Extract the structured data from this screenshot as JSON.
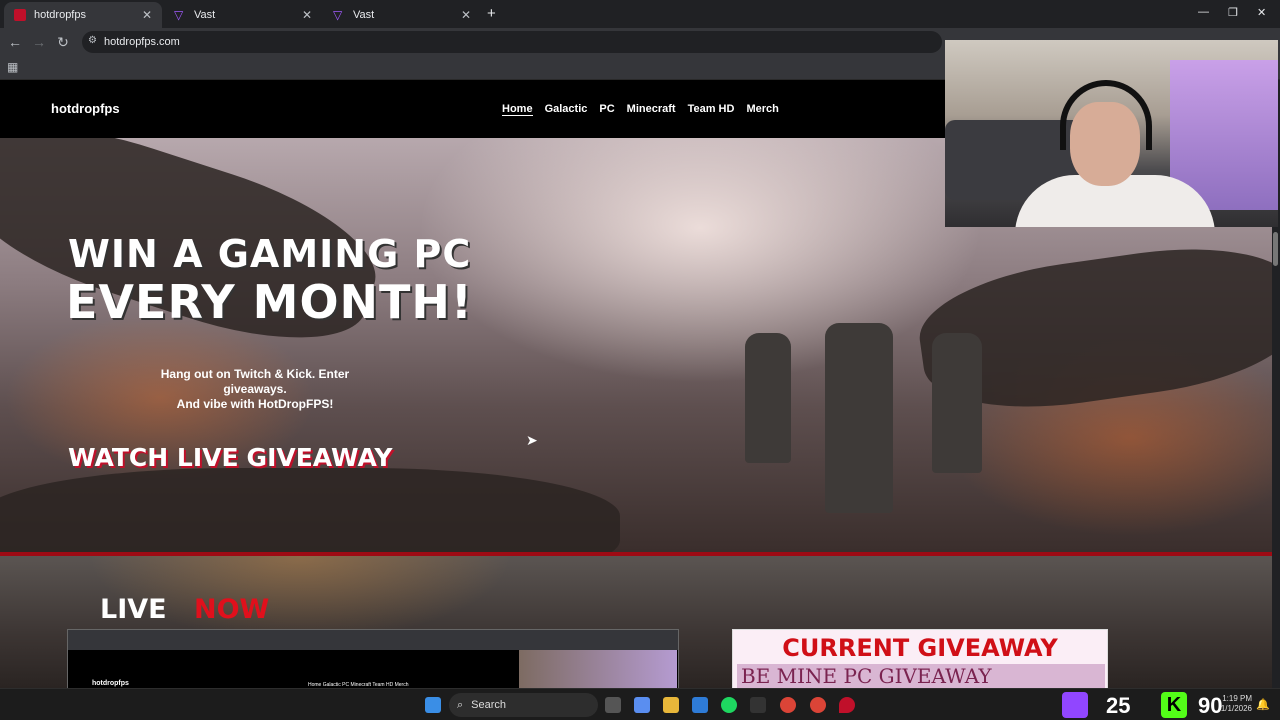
{
  "browser": {
    "tabs": [
      {
        "title": "hotdropfps",
        "active": true
      },
      {
        "title": "Vast",
        "active": false
      },
      {
        "title": "Vast",
        "active": false
      }
    ],
    "url": "hotdropfps.com"
  },
  "site": {
    "brand": "hotdropfps",
    "nav": [
      "Home",
      "Galactic",
      "PC",
      "Minecraft",
      "Team HD",
      "Merch"
    ],
    "hero": {
      "headline_1": "WIN A GAMING PC",
      "headline_2": "EVERY MONTH!",
      "tagline_1": "Hang out on Twitch & Kick. Enter giveaways.",
      "tagline_2": "And vibe with HotDropFPS!",
      "cta_primary": "WATCH LIVE",
      "cta_secondary": "GIVEAWAY"
    },
    "live_section": {
      "live_label": "LIVE",
      "now_label": "NOW",
      "preview_brand": "hotdropfps",
      "preview_nav": "Home  Galactic  PC  Minecraft  Team HD  Merch"
    },
    "giveaway": {
      "title": "CURRENT GIVEAWAY",
      "subtitle": "BE MINE PC GIVEAWAY"
    }
  },
  "taskbar": {
    "search_placeholder": "Search",
    "twitch_count": "25",
    "kick_count": "90",
    "time": "1:19 PM",
    "date": "1/1/2026"
  },
  "colors": {
    "accent_red": "#9e0b14",
    "twitch": "#9146ff",
    "kick": "#53fc18"
  }
}
